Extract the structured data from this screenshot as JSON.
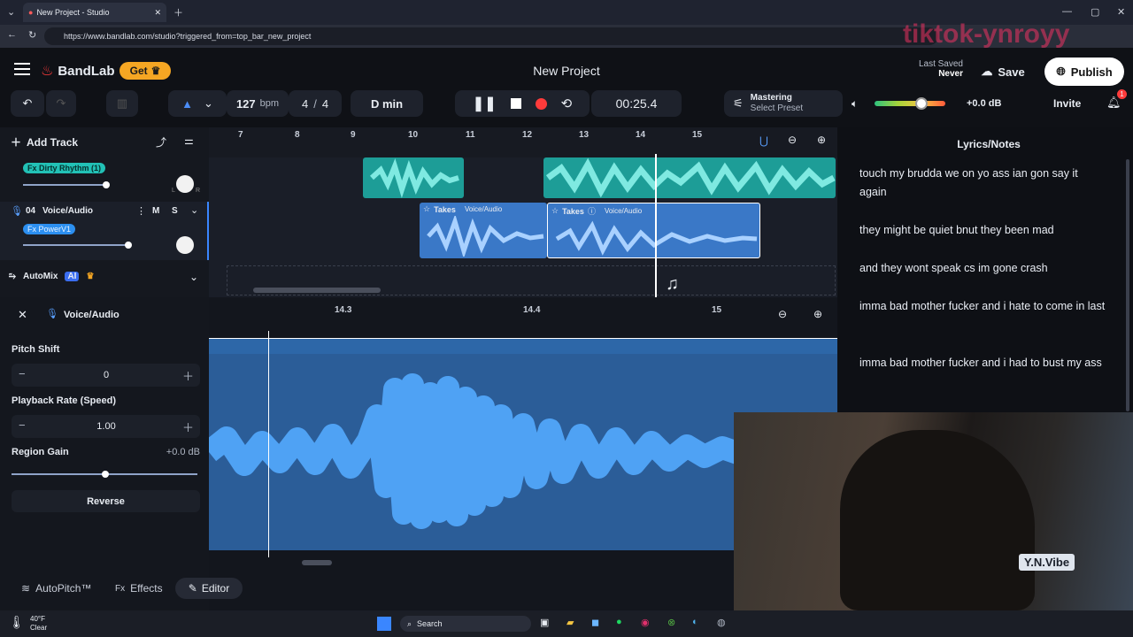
{
  "browser": {
    "tab_title": "New Project - Studio",
    "url": "https://www.bandlab.com/studio?triggered_from=top_bar_new_project"
  },
  "watermark": "tiktok-ynroyy",
  "header": {
    "brand": "BandLab",
    "get_label": "Get",
    "project_title": "New Project",
    "last_saved_label": "Last Saved",
    "last_saved_value": "Never",
    "save_label": "Save",
    "publish_label": "Publish"
  },
  "toolbar": {
    "tempo": "127",
    "tempo_unit": "bpm",
    "time_sig_num": "4",
    "time_sig_sep": "/",
    "time_sig_den": "4",
    "key": "D min",
    "time": "00:25.4",
    "mastering_label": "Mastering",
    "mastering_preset": "Select Preset",
    "volume_db": "+0.0 dB",
    "invite_label": "Invite",
    "notification_count": "1"
  },
  "tracks": {
    "add_track_label": "Add Track",
    "track3_fx": "Fx Dirty Rhythm (1)",
    "track4_number": "04",
    "track4_name": "Voice/Audio",
    "track4_fx": "Fx PowerV1",
    "mute_label": "M",
    "solo_label": "S",
    "automix_label": "AutoMix",
    "automix_badge": "AI",
    "pan_left": "L",
    "pan_right": "R",
    "take1_label": "Takes",
    "take1_name": "Voice/Audio",
    "take2_label": "Takes",
    "take2_name": "Voice/Audio"
  },
  "ruler": [
    "7",
    "8",
    "9",
    "10",
    "11",
    "12",
    "13",
    "14",
    "15"
  ],
  "lyrics": {
    "title": "Lyrics/Notes",
    "lines": [
      "touch my brudda we on yo ass ian gon say it again",
      "they might be quiet bnut they been mad",
      "and they wont speak cs im gone crash",
      "imma bad mother fucker and i hate to come in last",
      "imma bad mother fucker and i had to bust my ass"
    ]
  },
  "editor": {
    "title": "Voice/Audio",
    "pitch_label": "Pitch Shift",
    "pitch_value": "0",
    "rate_label": "Playback Rate (Speed)",
    "rate_value": "1.00",
    "gain_label": "Region Gain",
    "gain_value": "+0.0 dB",
    "reverse_label": "Reverse",
    "ruler": [
      "14.3",
      "14.4",
      "15"
    ],
    "tabs": {
      "autopitch": "AutoPitch™",
      "effects_prefix": "Fx",
      "effects": "Effects",
      "editor": "Editor"
    }
  },
  "webcam": {
    "overlay_text": "Y.N.Vibe"
  },
  "taskbar": {
    "weather_temp": "40°F",
    "weather_desc": "Clear",
    "search_label": "Search"
  },
  "colors": {
    "accent_orange": "#f5a623",
    "record_red": "#ff3b3b",
    "teal_region": "#1d9d97",
    "blue_region": "#3a78c7",
    "waveform": "#55a6f0"
  }
}
